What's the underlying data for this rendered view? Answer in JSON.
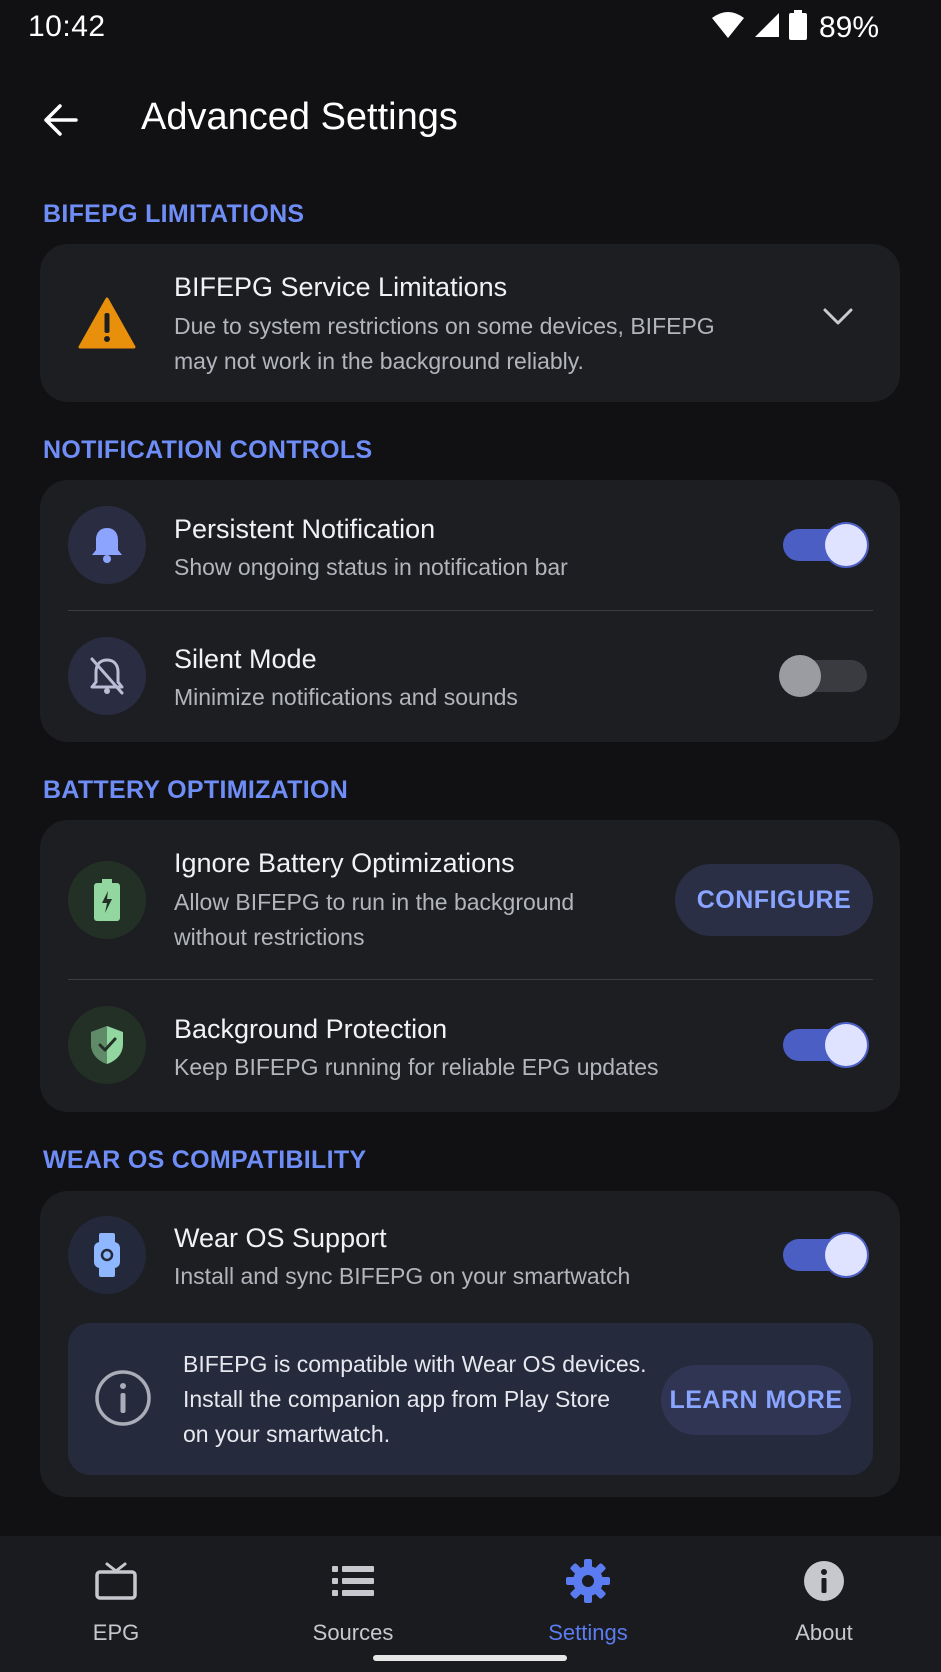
{
  "status_bar": {
    "time": "10:42",
    "battery": "89%"
  },
  "app_bar": {
    "title": "Advanced Settings"
  },
  "sections": {
    "limitations": {
      "header": "BIFEPG LIMITATIONS",
      "title": "BIFEPG Service Limitations",
      "subtitle_line1": "Due to system restrictions on some devices, BIFEPG",
      "subtitle_line2": "may not work in the background reliably.",
      "icon": "warning-icon",
      "expanded": false
    },
    "notifications": {
      "header": "NOTIFICATION CONTROLS",
      "persistent": {
        "title": "Persistent Notification",
        "subtitle": "Show ongoing status in notification bar",
        "icon": "bell-icon",
        "enabled": true
      },
      "silent": {
        "title": "Silent Mode",
        "subtitle": "Minimize notifications and sounds",
        "icon": "bell-off-icon",
        "enabled": false
      }
    },
    "battery": {
      "header": "BATTERY OPTIMIZATION",
      "ignore": {
        "title": "Ignore Battery Optimizations",
        "subtitle_line1": "Allow BIFEPG to run in the background",
        "subtitle_line2": "without restrictions",
        "button": "CONFIGURE",
        "icon": "battery-icon"
      },
      "protection": {
        "title": "Background Protection",
        "subtitle": "Keep BIFEPG running for reliable EPG updates",
        "icon": "shield-icon",
        "enabled": true
      }
    },
    "wear": {
      "header": "WEAR OS COMPATIBILITY",
      "support": {
        "title": "Wear OS Support",
        "subtitle": "Install and sync BIFEPG on your smartwatch",
        "icon": "watch-icon",
        "enabled": true
      },
      "info": {
        "line1": "BIFEPG is compatible with Wear OS devices.",
        "line2": "Install the companion app from Play Store",
        "line3": "on your smartwatch.",
        "button": "LEARN MORE",
        "icon": "info-icon"
      }
    }
  },
  "bottom_nav": {
    "items": [
      {
        "label": "EPG",
        "icon": "tv-icon",
        "active": false
      },
      {
        "label": "Sources",
        "icon": "list-icon",
        "active": false
      },
      {
        "label": "Settings",
        "icon": "gear-icon",
        "active": true
      },
      {
        "label": "About",
        "icon": "info-icon",
        "active": false
      }
    ]
  },
  "colors": {
    "background": "#111113",
    "card": "#1d1e22",
    "accent": "#6f8df6",
    "warning": "#e8900c",
    "toggle_on": "#4b5ec4"
  }
}
